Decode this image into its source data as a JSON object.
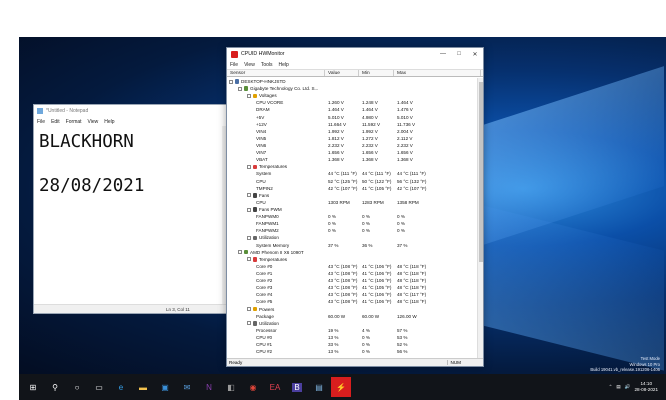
{
  "notepad": {
    "title": "*Untitled - Notepad",
    "menu": [
      "File",
      "Edit",
      "Format",
      "View",
      "Help"
    ],
    "lines": [
      "BLACKHORN",
      "",
      "28/08/2021"
    ],
    "status": "Ln 3, Col 11"
  },
  "hwmonitor": {
    "title": "CPUID HWMonitor",
    "menu": [
      "File",
      "View",
      "Tools",
      "Help"
    ],
    "columns": [
      "Sensor",
      "Value",
      "Min",
      "Max"
    ],
    "status_left": "Ready",
    "status_right": "NUM",
    "rows": [
      {
        "level": 0,
        "label": "DESKTOP-HNKJSTD",
        "icon": "computer-icon",
        "color": "#4a6fa5"
      },
      {
        "level": 1,
        "label": "Gigabyte Technology Co. Ltd. S...",
        "icon": "motherboard-icon",
        "color": "#5a8f3a"
      },
      {
        "level": 2,
        "label": "Voltages",
        "icon": "voltage-icon",
        "color": "#e0a000"
      },
      {
        "level": 3,
        "label": "CPU VCORE",
        "v": "1.260 V",
        "mn": "1.248 V",
        "mx": "1.464 V"
      },
      {
        "level": 3,
        "label": "DRAM",
        "v": "1.464 V",
        "mn": "1.464 V",
        "mx": "1.476 V"
      },
      {
        "level": 3,
        "label": "+5V",
        "v": "5.010 V",
        "mn": "4.980 V",
        "mx": "5.010 V"
      },
      {
        "level": 3,
        "label": "+12V",
        "v": "11.664 V",
        "mn": "11.592 V",
        "mx": "11.736 V"
      },
      {
        "level": 3,
        "label": "VIN4",
        "v": "1.992 V",
        "mn": "1.992 V",
        "mx": "2.004 V"
      },
      {
        "level": 3,
        "label": "VIN5",
        "v": "1.812 V",
        "mn": "1.272 V",
        "mx": "2.112 V"
      },
      {
        "level": 3,
        "label": "VIN6",
        "v": "2.232 V",
        "mn": "2.232 V",
        "mx": "2.232 V"
      },
      {
        "level": 3,
        "label": "VIN7",
        "v": "1.656 V",
        "mn": "1.656 V",
        "mx": "1.656 V"
      },
      {
        "level": 3,
        "label": "VBAT",
        "v": "1.368 V",
        "mn": "1.368 V",
        "mx": "1.368 V"
      },
      {
        "level": 2,
        "label": "Temperatures",
        "icon": "thermometer-icon",
        "color": "#d83b3b"
      },
      {
        "level": 3,
        "label": "System",
        "v": "44 °C (111 °F)",
        "mn": "44 °C (111 °F)",
        "mx": "44 °C (111 °F)"
      },
      {
        "level": 3,
        "label": "CPU",
        "v": "52 °C (125 °F)",
        "mn": "50 °C (122 °F)",
        "mx": "56 °C (132 °F)"
      },
      {
        "level": 3,
        "label": "TMPIN2",
        "v": "42 °C (107 °F)",
        "mn": "41 °C (105 °F)",
        "mx": "42 °C (107 °F)"
      },
      {
        "level": 2,
        "label": "Fans",
        "icon": "fan-icon",
        "color": "#444444"
      },
      {
        "level": 3,
        "label": "CPU",
        "v": "1303 RPM",
        "mn": "1283 RPM",
        "mx": "1358 RPM"
      },
      {
        "level": 2,
        "label": "Fans PWM",
        "icon": "fan-icon",
        "color": "#444444"
      },
      {
        "level": 3,
        "label": "FANPWM0",
        "v": "0 %",
        "mn": "0 %",
        "mx": "0 %"
      },
      {
        "level": 3,
        "label": "FANPWM1",
        "v": "0 %",
        "mn": "0 %",
        "mx": "0 %"
      },
      {
        "level": 3,
        "label": "FANPWM2",
        "v": "0 %",
        "mn": "0 %",
        "mx": "0 %"
      },
      {
        "level": 2,
        "label": "Utilization",
        "icon": "utilization-icon",
        "color": "#666666"
      },
      {
        "level": 3,
        "label": "System Memory",
        "v": "37 %",
        "mn": "36 %",
        "mx": "37 %"
      },
      {
        "level": 1,
        "label": "AMD Phenom II X6 1090T",
        "icon": "cpu-icon",
        "color": "#5a8f3a"
      },
      {
        "level": 2,
        "label": "Temperatures",
        "icon": "thermometer-icon",
        "color": "#d83b3b"
      },
      {
        "level": 3,
        "label": "Core #0",
        "v": "43 °C (108 °F)",
        "mn": "41 °C (106 °F)",
        "mx": "48 °C (118 °F)"
      },
      {
        "level": 3,
        "label": "Core #1",
        "v": "43 °C (108 °F)",
        "mn": "41 °C (106 °F)",
        "mx": "48 °C (118 °F)"
      },
      {
        "level": 3,
        "label": "Core #2",
        "v": "43 °C (108 °F)",
        "mn": "41 °C (106 °F)",
        "mx": "48 °C (118 °F)"
      },
      {
        "level": 3,
        "label": "Core #3",
        "v": "43 °C (108 °F)",
        "mn": "41 °C (105 °F)",
        "mx": "48 °C (118 °F)"
      },
      {
        "level": 3,
        "label": "Core #4",
        "v": "43 °C (108 °F)",
        "mn": "41 °C (106 °F)",
        "mx": "48 °C (117 °F)"
      },
      {
        "level": 3,
        "label": "Core #5",
        "v": "43 °C (108 °F)",
        "mn": "41 °C (106 °F)",
        "mx": "48 °C (118 °F)"
      },
      {
        "level": 2,
        "label": "Powers",
        "icon": "power-icon",
        "color": "#e0a000"
      },
      {
        "level": 3,
        "label": "Package",
        "v": "60.00 W",
        "mn": "60.00 W",
        "mx": "126.00 W"
      },
      {
        "level": 2,
        "label": "Utilization",
        "icon": "utilization-icon",
        "color": "#666666"
      },
      {
        "level": 3,
        "label": "Processor",
        "v": "19 %",
        "mn": "4 %",
        "mx": "57 %"
      },
      {
        "level": 3,
        "label": "CPU #0",
        "v": "13 %",
        "mn": "0 %",
        "mx": "53 %"
      },
      {
        "level": 3,
        "label": "CPU #1",
        "v": "33 %",
        "mn": "0 %",
        "mx": "52 %"
      },
      {
        "level": 3,
        "label": "CPU #2",
        "v": "13 %",
        "mn": "0 %",
        "mx": "56 %"
      }
    ]
  },
  "watermark": [
    "Test Mode",
    "Windows 10 Pro",
    "Build 19041.vb_release.191206-1406"
  ],
  "taskbar": {
    "icons": [
      "windows-start-icon",
      "search-icon",
      "cortana-icon",
      "task-view-icon",
      "edge-icon",
      "file-explorer-icon",
      "store-icon",
      "mail-icon",
      "onenote-icon",
      "unknown-app-icon",
      "chrome-icon",
      "ea-app-icon",
      "purple-app-icon",
      "notepad-icon",
      "hwmonitor-icon"
    ],
    "time": "14:10",
    "date": "28-08-2021"
  }
}
